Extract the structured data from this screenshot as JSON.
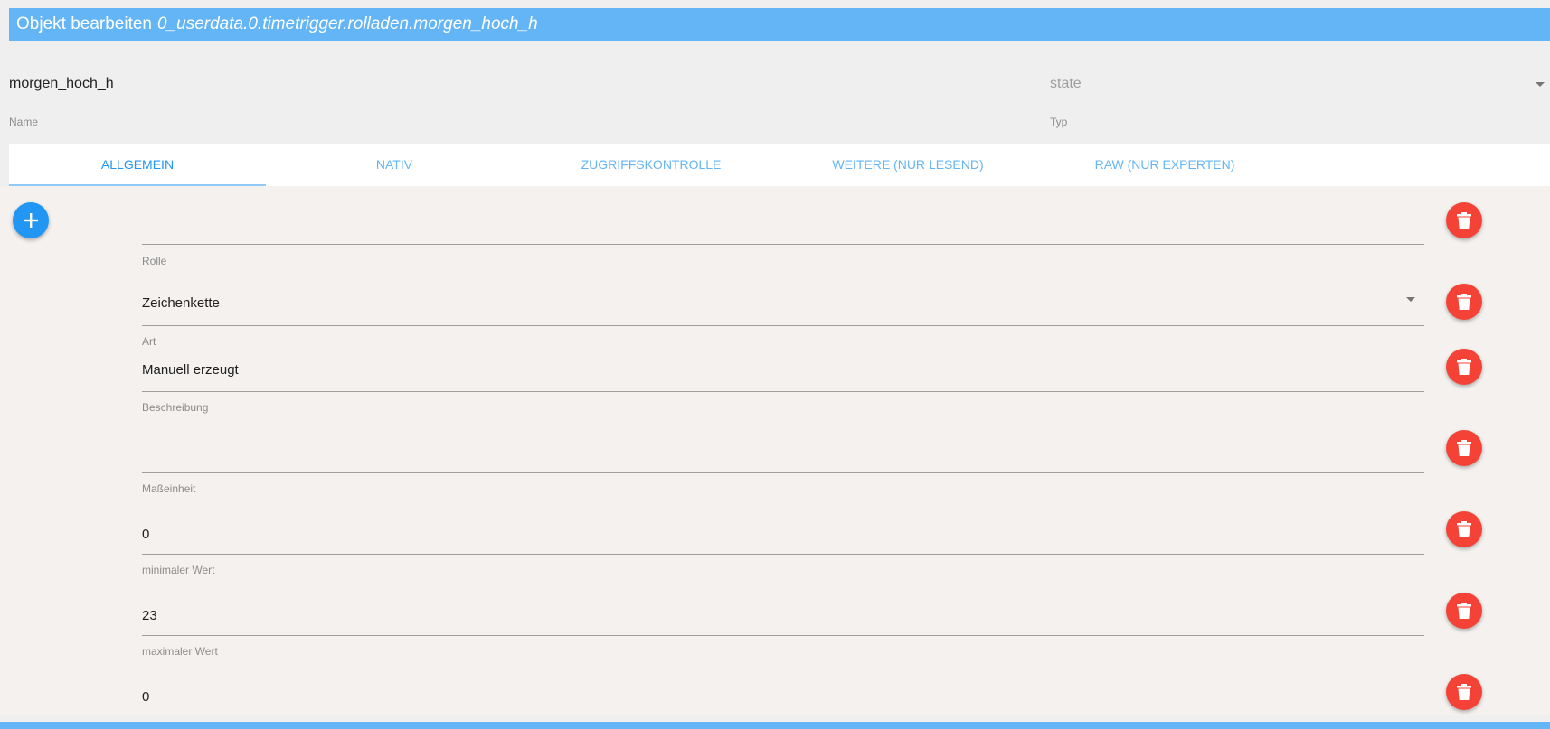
{
  "dialog": {
    "title_prefix": "Objekt bearbeiten",
    "object_id": "0_userdata.0.timetrigger.rolladen.morgen_hoch_h"
  },
  "name_field": {
    "value": "morgen_hoch_h",
    "label": "Name"
  },
  "type_field": {
    "value": "state",
    "label": "Typ"
  },
  "tabs": [
    {
      "label": "ALLGEMEIN",
      "active": true
    },
    {
      "label": "NATIV",
      "active": false
    },
    {
      "label": "ZUGRIFFSKONTROLLE",
      "active": false
    },
    {
      "label": "WEITERE (NUR LESEND)",
      "active": false
    },
    {
      "label": "RAW (NUR EXPERTEN)",
      "active": false
    }
  ],
  "fields": {
    "rolle": {
      "label": "Rolle",
      "value": ""
    },
    "art": {
      "label": "Art",
      "value": "Zeichenkette"
    },
    "beschreibung": {
      "label": "Beschreibung",
      "value": "Manuell erzeugt"
    },
    "masseinheit": {
      "label": "Maßeinheit",
      "value": ""
    },
    "min": {
      "label": "minimaler Wert",
      "value": "0"
    },
    "max": {
      "label": "maximaler Wert",
      "value": "23"
    },
    "default": {
      "value": "0"
    }
  },
  "icons": {
    "add": "plus-icon",
    "delete": "trash-icon",
    "dropdown": "caret-down-icon"
  },
  "colors": {
    "header": "#64b5f6",
    "tab_accent": "#2196f3",
    "add_button": "#2196f3",
    "delete_button": "#f44336"
  }
}
